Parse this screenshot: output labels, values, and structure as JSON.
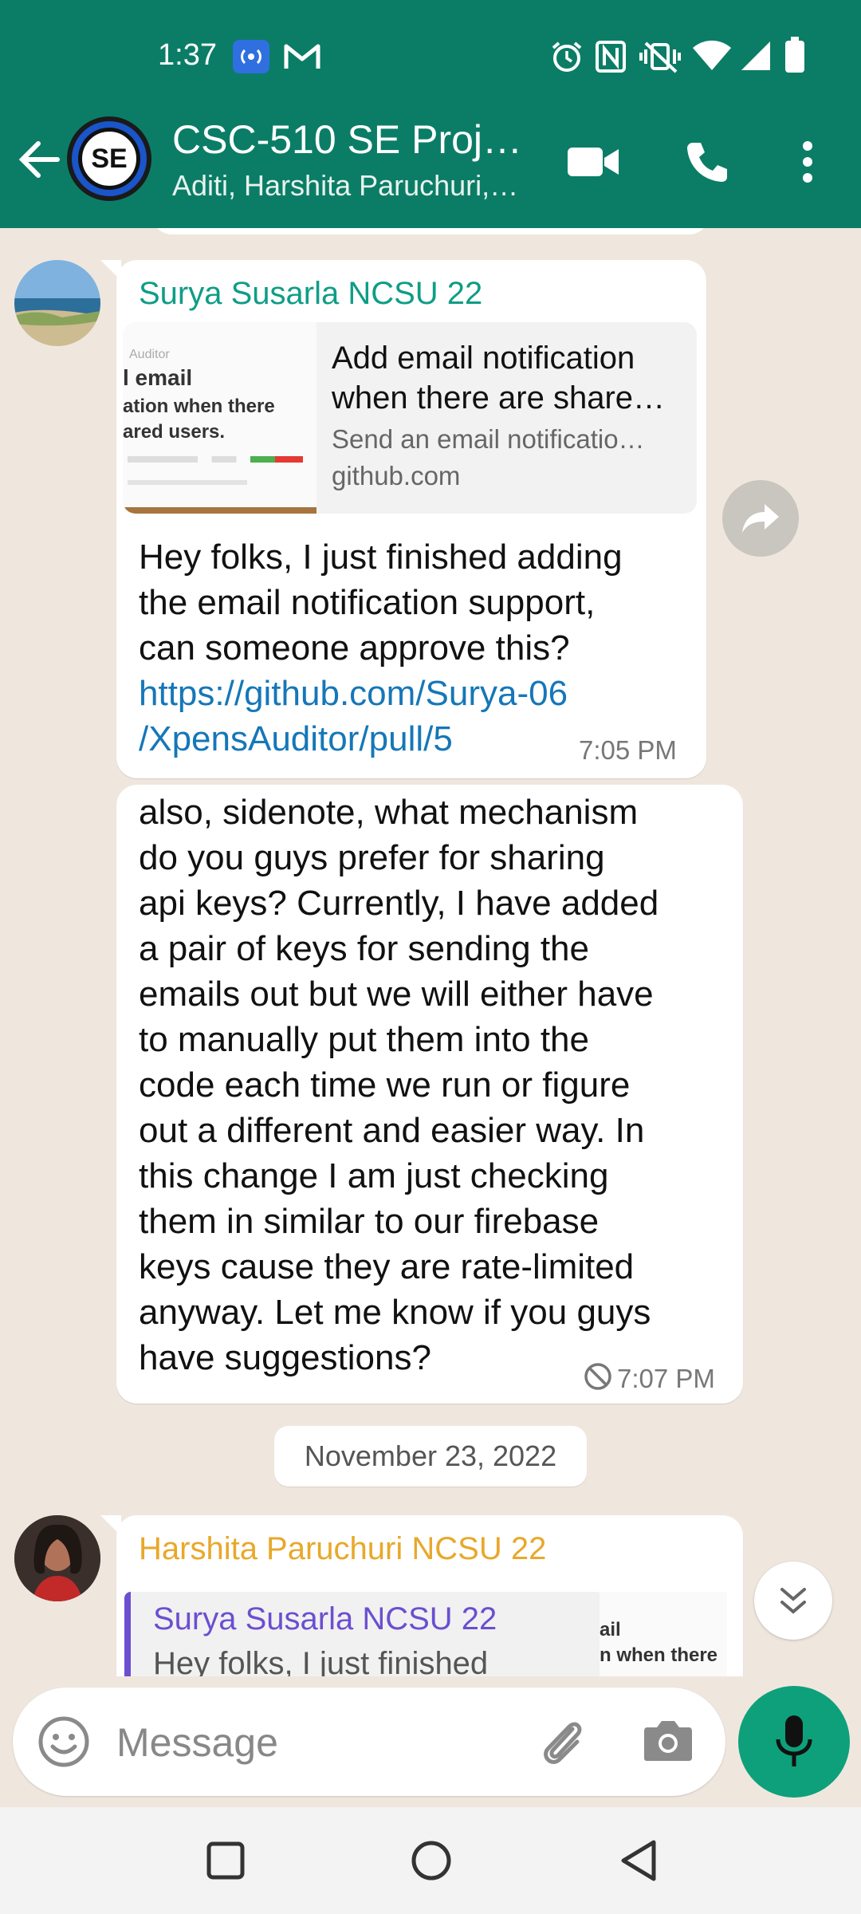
{
  "status_bar": {
    "time": "1:37",
    "left_icons": [
      "broadcast-icon",
      "gmail-icon"
    ],
    "right_icons": [
      "alarm-icon",
      "nfc-icon",
      "vibrate-icon",
      "wifi-icon",
      "signal-icon",
      "battery-icon"
    ]
  },
  "header": {
    "title": "CSC-510 SE Proj…",
    "subtitle": "Aditi, Harshita Paruchuri,…",
    "avatar_text": "SE",
    "colors": {
      "bar": "#0b7d66"
    }
  },
  "messages": {
    "m1": {
      "sender": "Surya Susarla NCSU 22",
      "sender_color": "#0f9d86",
      "preview": {
        "title_line1": "Add email notification",
        "title_line2": "when there are share…",
        "description": "Send an email notificatio…",
        "site": "github.com",
        "thumb_lines": [
          "Auditor",
          "l email",
          "ation when there",
          "ared users."
        ]
      },
      "text_lines": [
        "Hey folks, I just finished adding",
        "the email notification support,",
        "can someone approve this?"
      ],
      "link_line1": "https://github.com/Surya-06",
      "link_line2": "/XpensAuditor/pull/5",
      "time": "7:05 PM"
    },
    "m2": {
      "text_lines": [
        "also, sidenote, what mechanism",
        "do you guys prefer for sharing",
        "api keys? Currently, I have added",
        "a pair of keys for sending the",
        "emails out but we will either have",
        "to manually put them into the",
        "code each time we run or figure",
        "out a different and easier way. In",
        "this change I am just checking",
        "them in similar to our firebase",
        "keys cause they are rate-limited",
        "anyway. Let me know if you guys",
        "have suggestions?"
      ],
      "time": "7:07 PM"
    },
    "date_divider": "November 23, 2022",
    "m3": {
      "sender": "Harshita Paruchuri NCSU 22",
      "sender_color": "#e8a82a",
      "quote_name": "Surya Susarla NCSU 22",
      "quote_text": "Hey folks, I just finished",
      "quote_thumb_lines": [
        "ail",
        "n when there"
      ]
    }
  },
  "composer": {
    "placeholder": "Message"
  }
}
